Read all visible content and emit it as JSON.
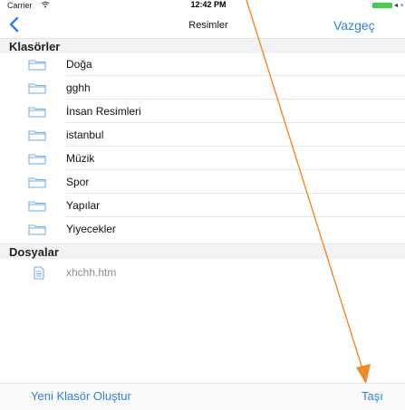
{
  "status_bar": {
    "carrier": "Carrier",
    "time": "12:42 PM",
    "wifi_icon": "wifi-icon",
    "battery_icon": "battery-icon"
  },
  "nav": {
    "back_icon": "chevron-left-icon",
    "title": "Resimler",
    "cancel_label": "Vazgeç"
  },
  "folders_section": {
    "header": "Klasörler",
    "items": [
      {
        "label": "Doğa",
        "icon": "folder-icon"
      },
      {
        "label": "gghh",
        "icon": "folder-icon"
      },
      {
        "label": "İnsan Resimleri",
        "icon": "folder-icon"
      },
      {
        "label": "istanbul",
        "icon": "folder-icon"
      },
      {
        "label": "Müzik",
        "icon": "folder-icon"
      },
      {
        "label": "Spor",
        "icon": "folder-icon"
      },
      {
        "label": "Yapılar",
        "icon": "folder-icon"
      },
      {
        "label": "Yiyecekler",
        "icon": "folder-icon"
      }
    ]
  },
  "files_section": {
    "header": "Dosyalar",
    "items": [
      {
        "label": "xhchh.htm",
        "icon": "document-icon"
      }
    ]
  },
  "toolbar": {
    "new_folder_label": "Yeni Klasör Oluştur",
    "move_label": "Taşı"
  },
  "colors": {
    "accent": "#2a7fe8",
    "folder_icon": "#6fb0ea",
    "section_background": "#f2f2f4",
    "annotation_arrow": "#f08a24"
  }
}
